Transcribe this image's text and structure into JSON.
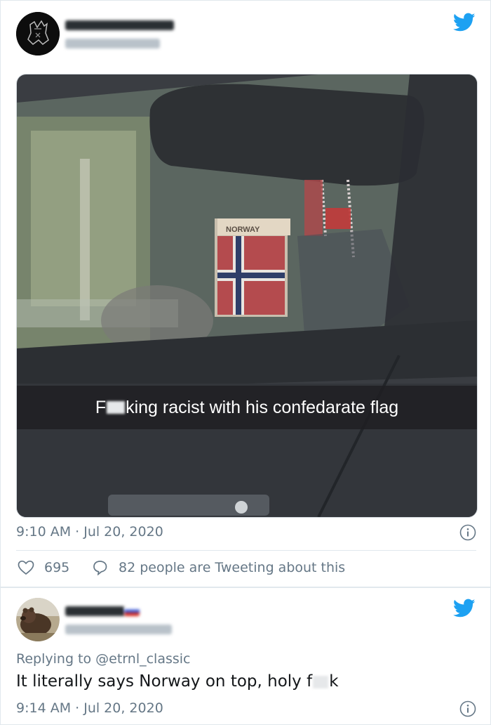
{
  "tweet1": {
    "caption_prefix": "F",
    "caption_suffix": "king racist with his confedarate flag",
    "flag_text": "NORWAY",
    "timestamp": "9:10 AM · Jul 20, 2020",
    "likes": "695",
    "tweeting_text": "82 people are Tweeting about this"
  },
  "tweet2": {
    "replying_prefix": "Replying to ",
    "replying_handle": "@etrnl_classic",
    "text_prefix": "It literally says Norway on top, holy f",
    "text_suffix": "k",
    "timestamp": "9:14 AM · Jul 20, 2020"
  },
  "colors": {
    "twitter_blue": "#1da1f2",
    "meta_gray": "#657786"
  },
  "icons": [
    "twitter-bird-icon",
    "info-icon",
    "heart-icon",
    "comment-icon"
  ]
}
